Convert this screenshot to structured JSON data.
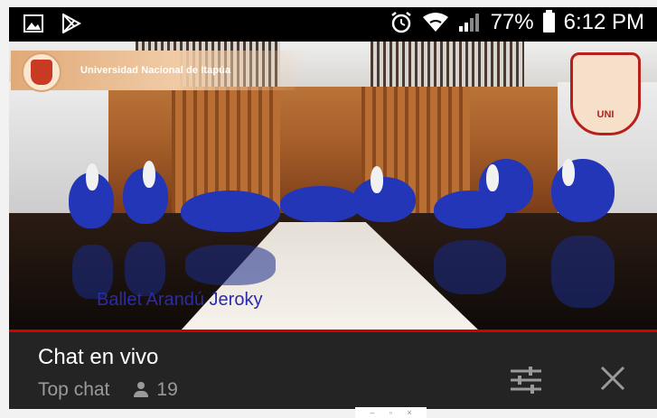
{
  "statusbar": {
    "battery_percent": "77%",
    "time": "6:12 PM",
    "icons": [
      "image-icon",
      "play-store-icon",
      "alarm-icon",
      "wifi-icon",
      "signal-icon",
      "battery-icon"
    ]
  },
  "video": {
    "institution": "Universidad Nacional de Itapúa",
    "crest_label": "UNI",
    "overlay_caption": "Ballet Arandú Jeroky",
    "progress_fraction": 1.0,
    "progress_color": "#d40000"
  },
  "chat": {
    "title": "Chat en vivo",
    "mode": "Top chat",
    "viewer_count": "19",
    "icons": [
      "person-icon",
      "tune-icon",
      "close-icon"
    ]
  },
  "window_controls": {
    "minimize": "–",
    "maximize": "▫",
    "close": "×"
  }
}
